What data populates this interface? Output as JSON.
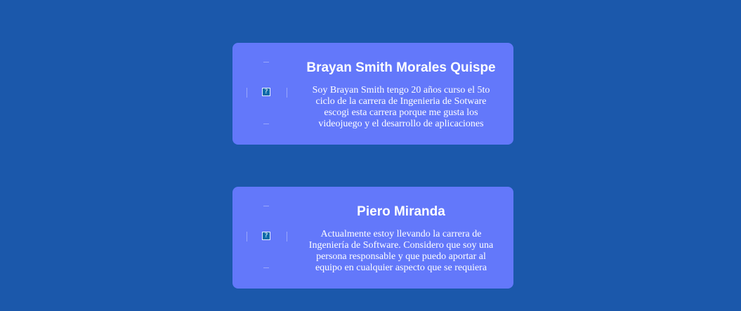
{
  "page": {
    "background_color": "#1b58ab",
    "card_color": "#6378fa"
  },
  "profiles": [
    {
      "name": "Brayan Smith Morales Quispe",
      "bio_lines": [
        "Soy Brayan Smith tengo 20 años curso el 5to",
        "ciclo de la carrera de Ingenieria de Sotware",
        "escogi esta carrera porque me gusta los",
        "videojuego y el desarrollo de aplicaciones"
      ],
      "photo_icon": "broken-image-icon"
    },
    {
      "name": "Piero Miranda",
      "bio_lines": [
        "Actualmente estoy llevando la carrera de",
        "Ingeniería de Software. Considero que soy una",
        "persona responsable y que puedo aportar al",
        "equipo en cualquier aspecto que se requiera"
      ],
      "photo_icon": "broken-image-icon"
    }
  ]
}
